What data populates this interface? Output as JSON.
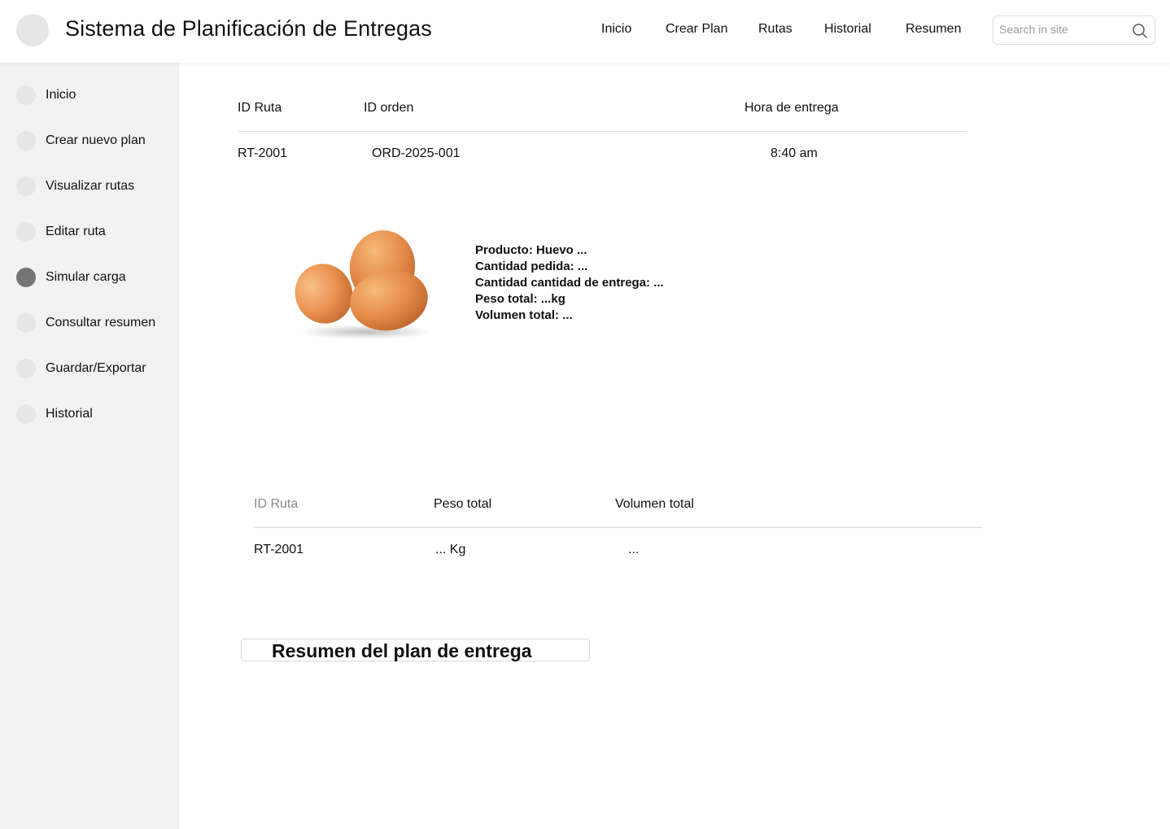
{
  "header": {
    "title": "Sistema de Planificación de Entregas",
    "nav": [
      "Inicio",
      "Crear Plan",
      "Rutas",
      "Historial",
      "Resumen"
    ],
    "search_placeholder": "Search in site"
  },
  "sidebar": {
    "items": [
      {
        "label": "Inicio"
      },
      {
        "label": "Crear nuevo plan"
      },
      {
        "label": "Visualizar rutas"
      },
      {
        "label": "Editar ruta"
      },
      {
        "label": "Simular carga",
        "active": true
      },
      {
        "label": "Consultar resumen"
      },
      {
        "label": "Guardar/Exportar"
      },
      {
        "label": "Historial"
      }
    ]
  },
  "orders_table": {
    "headers": [
      "ID Ruta",
      "ID orden",
      "Hora de entrega"
    ],
    "rows": [
      [
        "RT-2001",
        "ORD-2025-001",
        "8:40 am"
      ]
    ]
  },
  "product": {
    "image": "brown-eggs",
    "lines": [
      "Producto: Huevo ...",
      "Cantidad pedida: ...",
      "Cantidad cantidad de entrega: ...",
      "Peso total: ...kg",
      "Volumen total: ..."
    ]
  },
  "load_table": {
    "headers": [
      "ID Ruta",
      "Peso total",
      "Volumen total"
    ],
    "rows": [
      [
        "RT-2001",
        "... Kg",
        "..."
      ]
    ]
  },
  "summary_button": {
    "label": "Resumen del plan de entrega"
  },
  "colors": {
    "sidebar_bg": "#f2f2f2",
    "active_dot": "#757575",
    "inactive_dot": "#e6e6e6"
  }
}
